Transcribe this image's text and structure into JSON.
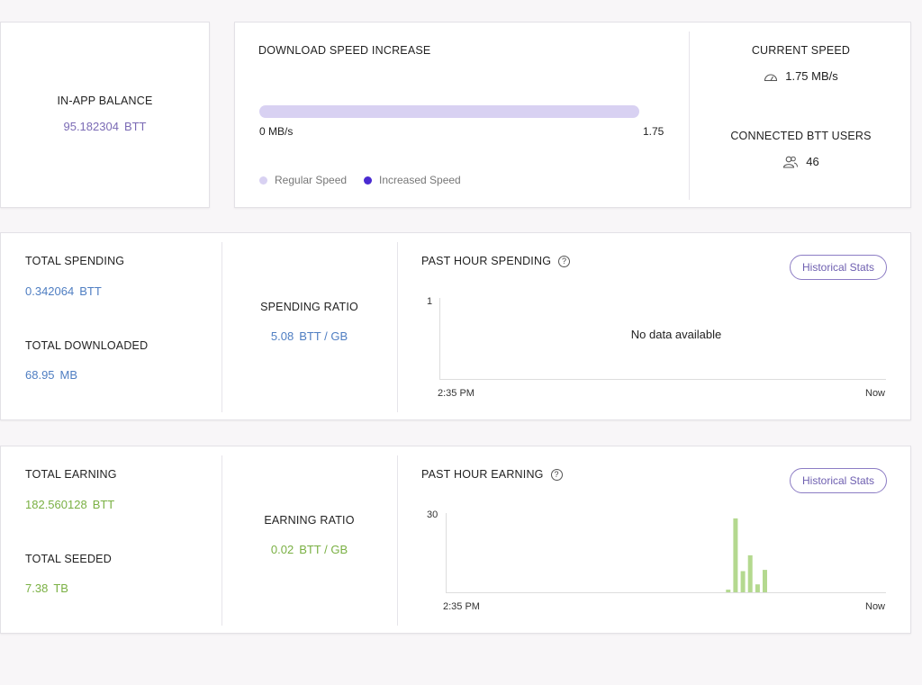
{
  "balance": {
    "label": "IN-APP BALANCE",
    "value": "95.182304",
    "unit": "BTT"
  },
  "speed": {
    "title": "DOWNLOAD SPEED INCREASE",
    "bar_min": "0 MB/s",
    "bar_max": "1.75",
    "legend_regular": "Regular Speed",
    "legend_increased": "Increased Speed",
    "current_speed_label": "CURRENT SPEED",
    "current_speed_value": "1.75 MB/s",
    "users_label": "CONNECTED BTT USERS",
    "users_value": "46",
    "colors": {
      "regular": "#d8d1f2",
      "increased": "#4a2bd1"
    }
  },
  "spending": {
    "total_label": "TOTAL SPENDING",
    "total_value": "0.342064",
    "total_unit": "BTT",
    "downloaded_label": "TOTAL DOWNLOADED",
    "downloaded_value": "68.95",
    "downloaded_unit": "MB",
    "ratio_label": "SPENDING RATIO",
    "ratio_value": "5.08",
    "ratio_unit": "BTT / GB",
    "chart_title": "PAST HOUR SPENDING",
    "hist_button": "Historical Stats",
    "y_max": "1",
    "x_start": "2:35 PM",
    "x_end": "Now",
    "empty_text": "No data available"
  },
  "earning": {
    "total_label": "TOTAL EARNING",
    "total_value": "182.560128",
    "total_unit": "BTT",
    "seeded_label": "TOTAL SEEDED",
    "seeded_value": "7.38",
    "seeded_unit": "TB",
    "ratio_label": "EARNING RATIO",
    "ratio_value": "0.02",
    "ratio_unit": "BTT / GB",
    "chart_title": "PAST HOUR EARNING",
    "hist_button": "Historical Stats",
    "y_max": "30",
    "x_start": "2:35 PM",
    "x_end": "Now"
  },
  "chart_data": {
    "type": "bar",
    "ylim": [
      0,
      30
    ],
    "x_range": [
      0,
      60
    ],
    "values": [
      {
        "x": 38.5,
        "y": 1
      },
      {
        "x": 39.5,
        "y": 28
      },
      {
        "x": 40.5,
        "y": 8
      },
      {
        "x": 41.5,
        "y": 14
      },
      {
        "x": 42.5,
        "y": 3
      },
      {
        "x": 43.5,
        "y": 8.5
      }
    ],
    "bar_color": "#b4d98f"
  }
}
